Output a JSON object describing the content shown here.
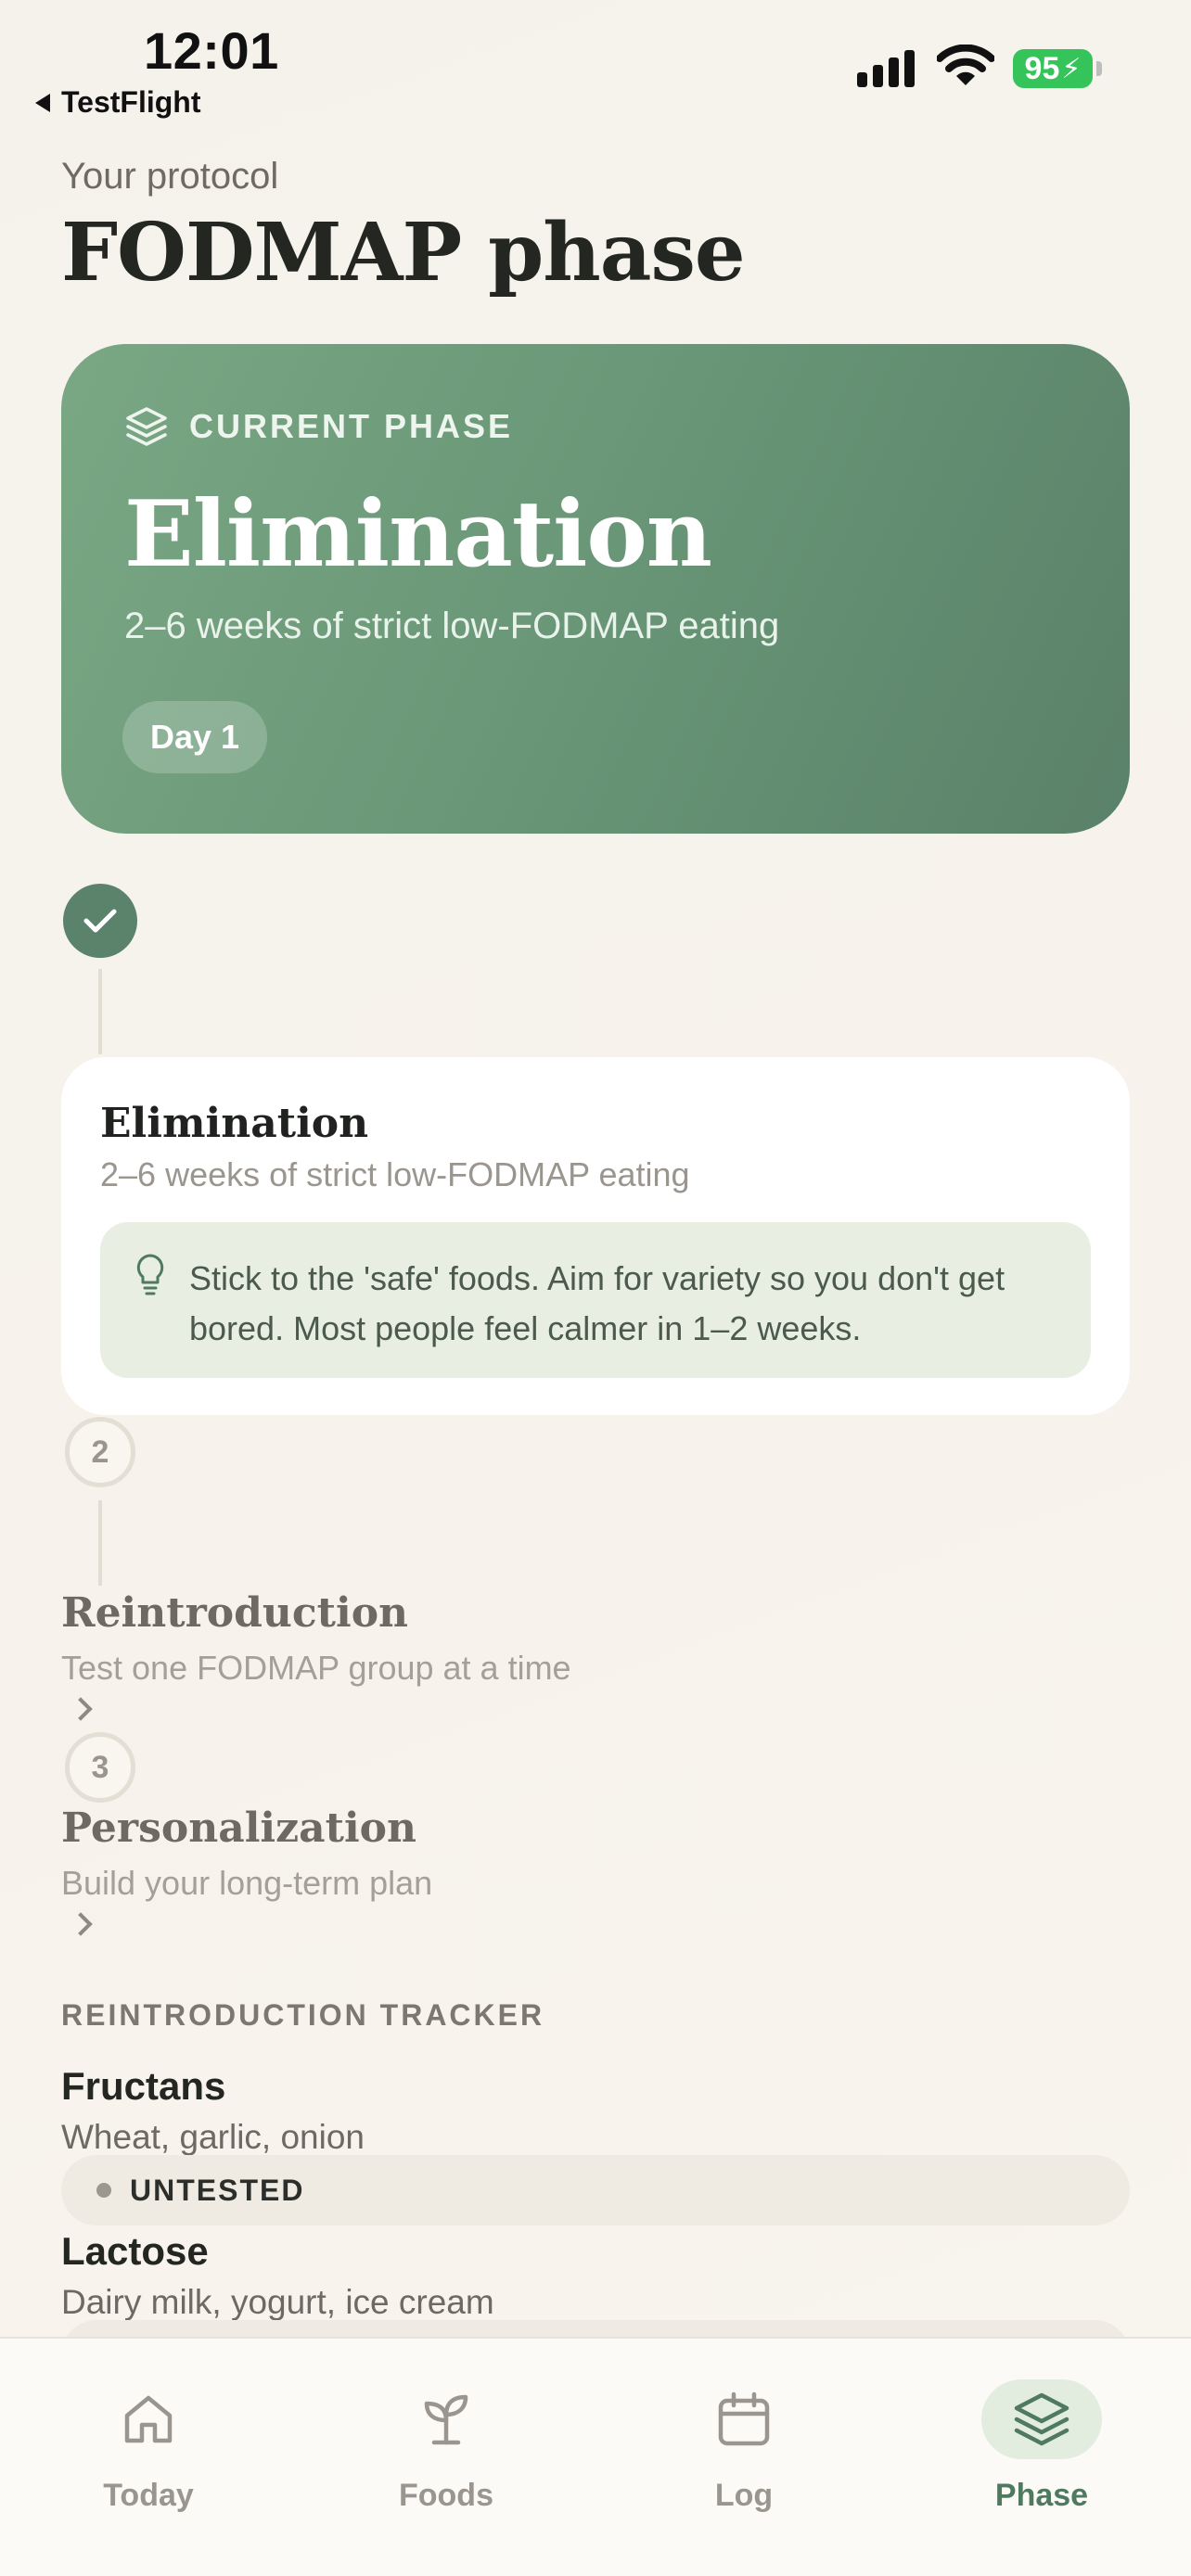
{
  "status_bar": {
    "time": "12:01",
    "back_app": "TestFlight",
    "battery": "95"
  },
  "header": {
    "eyebrow": "Your protocol",
    "title": "FODMAP phase"
  },
  "current_phase": {
    "label": "CURRENT PHASE",
    "title": "Elimination",
    "subtitle": "2–6 weeks of strict low-FODMAP eating",
    "day": "Day 1",
    "icon": "layers-icon"
  },
  "timeline": {
    "active": {
      "title": "Elimination",
      "subtitle": "2–6 weeks of strict low-FODMAP eating",
      "tip": "Stick to the 'safe' foods. Aim for variety so you don't get bored. Most people feel calmer in 1–2 weeks.",
      "icon": "lightbulb-icon"
    },
    "upcoming": [
      {
        "number": "2",
        "title": "Reintroduction",
        "subtitle": "Test one FODMAP group at a time"
      },
      {
        "number": "3",
        "title": "Personalization",
        "subtitle": "Build your long-term plan"
      }
    ]
  },
  "tracker": {
    "heading": "REINTRODUCTION TRACKER",
    "items": [
      {
        "name": "Fructans",
        "foods": "Wheat, garlic, onion",
        "status": "UNTESTED"
      },
      {
        "name": "Lactose",
        "foods": "Dairy milk, yogurt, ice cream",
        "status": ""
      }
    ]
  },
  "tabs": [
    {
      "label": "Today",
      "icon": "home-icon"
    },
    {
      "label": "Foods",
      "icon": "sprout-icon"
    },
    {
      "label": "Log",
      "icon": "calendar-icon"
    },
    {
      "label": "Phase",
      "icon": "layers-icon",
      "active": true
    }
  ],
  "colors": {
    "accent": "#5b826b",
    "hero_start": "#7aa784",
    "hero_end": "#5a8169",
    "tip_bg": "#e8efe2"
  }
}
